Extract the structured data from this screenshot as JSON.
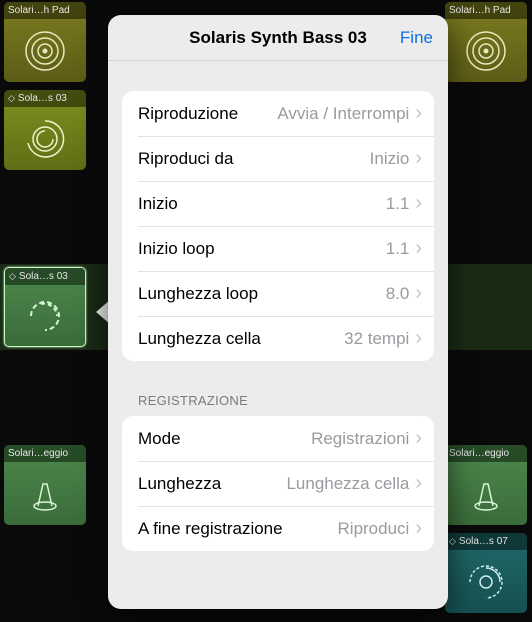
{
  "popover": {
    "title": "Solaris Synth Bass 03",
    "done_label": "Fine",
    "playback_rows": [
      {
        "label": "Riproduzione",
        "value": "Avvia / Interrompi"
      },
      {
        "label": "Riproduci da",
        "value": "Inizio"
      },
      {
        "label": "Inizio",
        "value": "1.1"
      },
      {
        "label": "Inizio loop",
        "value": "1.1"
      },
      {
        "label": "Lunghezza loop",
        "value": "8.0"
      },
      {
        "label": "Lunghezza cella",
        "value": "32 tempi"
      }
    ],
    "recording_header": "REGISTRAZIONE",
    "recording_rows": [
      {
        "label": "Mode",
        "value": "Registrazioni"
      },
      {
        "label": "Lunghezza",
        "value": "Lunghezza cella"
      },
      {
        "label": "A fine registrazione",
        "value": "Riproduci"
      }
    ]
  },
  "cells": {
    "row0_left": "Solari…h Pad",
    "row0_right": "Solari…h Pad",
    "row1_left": "Sola…s 03",
    "row2_left": "Sola…s 03",
    "row4_left": "Solari…eggio",
    "row4_right": "Solari…eggio",
    "row5_right": "Sola…s 07"
  }
}
